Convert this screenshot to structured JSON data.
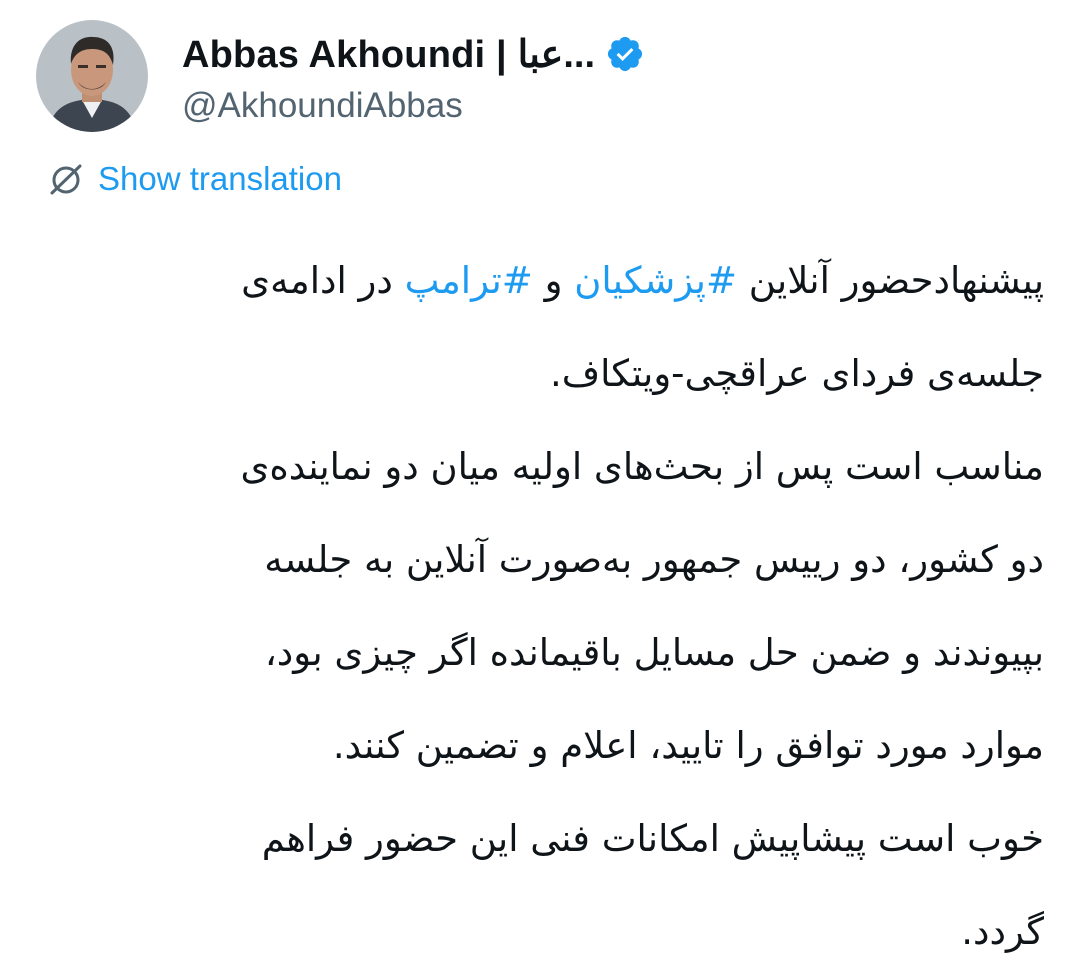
{
  "author": {
    "display_name": "Abbas Akhoundi | عبا...",
    "handle": "@AkhoundiAbbas",
    "verified": true,
    "avatar_icon": "profile-photo-icon"
  },
  "translation": {
    "label": "Show translation",
    "icon": "globe-slash-icon"
  },
  "tweet": {
    "lines": [
      {
        "pre": "پیشنهادحضور آنلاین ",
        "tag1": "#پزشکیان",
        "mid": " و ",
        "tag2": "#ترامپ",
        "post": " در ادامه‌ی"
      },
      "جلسه‌ی فردای عراقچی-ویتکاف.",
      "مناسب است پس از بحث‌های اولیه میان دو نماینده‌ی",
      "دو کشور، دو رییس جمهور به‌صورت آنلاین به جلسه",
      "بپیوندند و ضمن حل مسایل باقیمانده اگر چیزی بود،",
      "موارد مورد توافق را تایید، اعلام و تضمین کنند.",
      "خوب است پیشاپیش امکانات فنی این حضور فراهم",
      "گردد."
    ]
  },
  "colors": {
    "link": "#1d9bf0",
    "text": "#0f1419",
    "secondary": "#536471",
    "background": "#ffffff"
  }
}
